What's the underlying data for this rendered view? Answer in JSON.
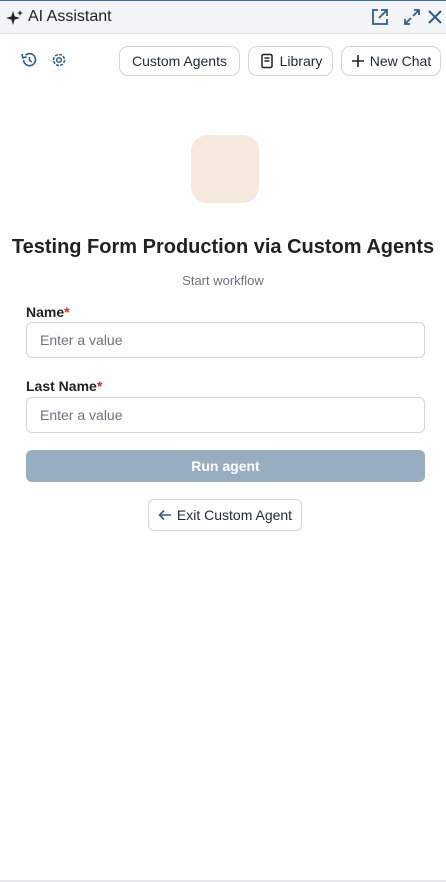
{
  "header": {
    "title": "AI Assistant",
    "icons": [
      "sparkle-icon",
      "external-link-icon",
      "expand-icon",
      "close-icon"
    ],
    "accent_color": "#2f5f8a"
  },
  "toolbar": {
    "icons": [
      "history-icon",
      "settings-icon"
    ],
    "custom_agents_label": "Custom Agents",
    "library_label": "Library",
    "new_chat_label": "New Chat"
  },
  "agent": {
    "avatar_color": "#f5e8dc",
    "title": "Testing Form Production via Custom Agents",
    "subtitle": "Start workflow"
  },
  "form": {
    "fields": [
      {
        "label": "Name",
        "required_mark": "*",
        "placeholder": "Enter a value",
        "value": ""
      },
      {
        "label": "Last Name",
        "required_mark": "*",
        "placeholder": "Enter a value",
        "value": ""
      }
    ],
    "run_label": "Run agent",
    "run_color": "#97adc0",
    "exit_label": "Exit Custom Agent"
  }
}
